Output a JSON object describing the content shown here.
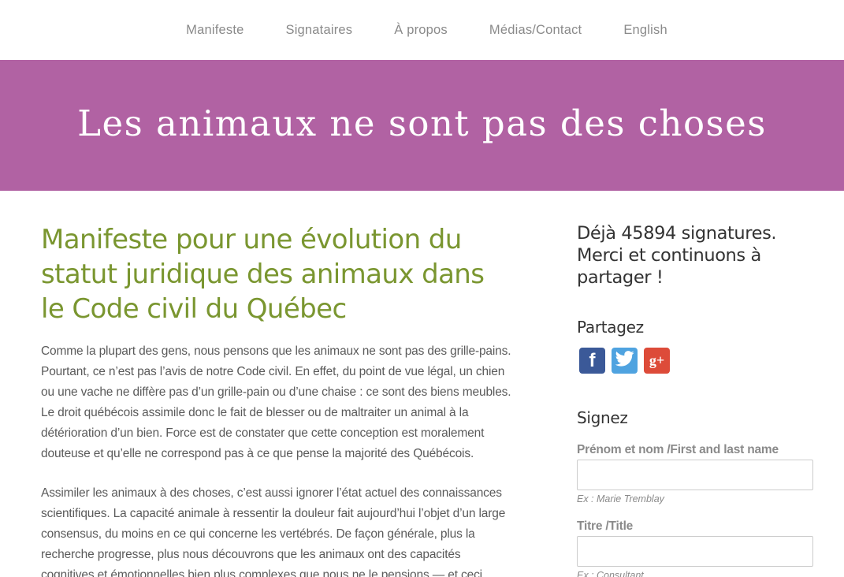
{
  "nav": {
    "items": [
      {
        "label": "Manifeste"
      },
      {
        "label": "Signataires"
      },
      {
        "label": "À propos"
      },
      {
        "label": "Médias/Contact"
      },
      {
        "label": "English"
      }
    ]
  },
  "banner": {
    "title": "Les animaux ne sont pas des choses",
    "color": "#b162a3"
  },
  "main": {
    "heading": "Manifeste pour une évolution du statut juridique des animaux dans le Code civil du Québec",
    "heading_color": "#7a9630",
    "paragraphs": [
      "Comme la plupart des gens, nous pensons que les animaux ne sont pas des grille-pains. Pourtant, ce n’est pas l’avis de notre Code civil. En effet, du point de vue légal, un chien ou une vache ne diffère pas d’un grille-pain ou d’une chaise : ce sont des biens meubles. Le droit québécois assimile donc le fait de blesser ou de maltraiter un animal à la détérioration d’un bien. Force est de constater que cette conception est moralement douteuse et qu’elle ne correspond pas à ce que pense la majorité des Québécois.",
      "Assimiler les animaux à des choses, c’est aussi ignorer l’état actuel des connaissances scientifiques. La capacité animale à ressentir la douleur fait aujourd’hui l’objet d’un large consensus, du moins en ce qui concerne les vertébrés. De façon générale, plus la recherche progresse, plus nous découvrons que les animaux ont des capacités cognitives et émotionnelles bien plus complexes que nous ne le pensions — et ceci"
    ]
  },
  "sidebar": {
    "count_text": "Déjà 45894 signatures. Merci et continuons à partager !",
    "share_title": "Partagez",
    "social": [
      {
        "icon": "facebook-icon",
        "glyph": "f",
        "color": "#3b5998"
      },
      {
        "icon": "twitter-icon",
        "color": "#4fa3e0"
      },
      {
        "icon": "google-plus-icon",
        "glyph": "g+",
        "color": "#dd4b39"
      }
    ],
    "sign_title": "Signez",
    "fields": [
      {
        "label": "Prénom et nom /First and last name",
        "value": "",
        "help": "Ex : Marie Tremblay"
      },
      {
        "label": "Titre /Title",
        "value": "",
        "help": "Ex : Consultant"
      }
    ]
  }
}
